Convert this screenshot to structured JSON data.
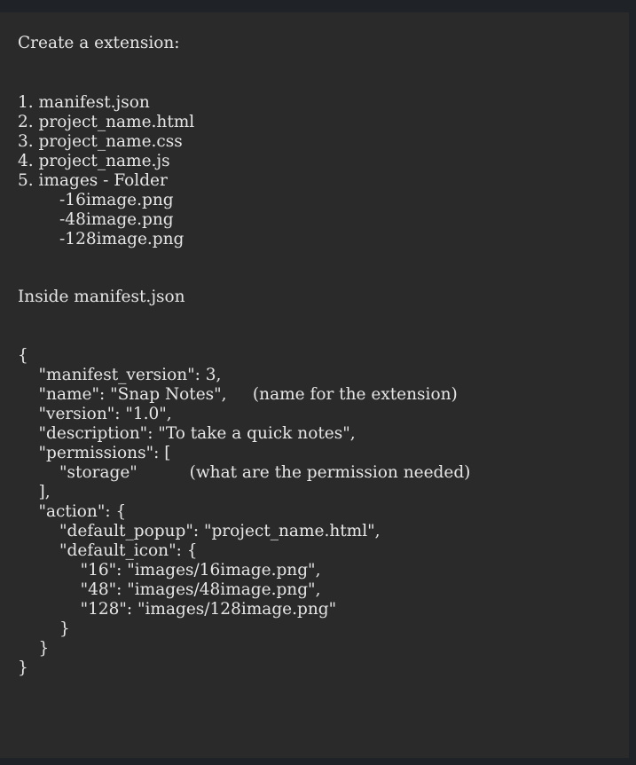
{
  "editor": {
    "lines": [
      "Create a extension:",
      "1. manifest.json",
      "2. project_name.html",
      "3. project_name.css",
      "4. project_name.js",
      "5. images - Folder",
      "        -16image.png",
      "        -48image.png",
      "        -128image.png",
      "Inside manifest.json",
      "{",
      "    \"manifest_version\": 3,",
      "    \"name\": \"Snap Notes\",     (name for the extension)",
      "    \"version\": \"1.0\",",
      "    \"description\": \"To take a quick notes\",",
      "    \"permissions\": [",
      "        \"storage\"          (what are the permission needed)",
      "    ],",
      "    \"action\": {",
      "        \"default_popup\": \"project_name.html\",",
      "        \"default_icon\": {",
      "            \"16\": \"images/16image.png\",",
      "            \"48\": \"images/48image.png\",",
      "            \"128\": \"images/128image.png\"",
      "        }",
      "    }",
      "}"
    ]
  }
}
